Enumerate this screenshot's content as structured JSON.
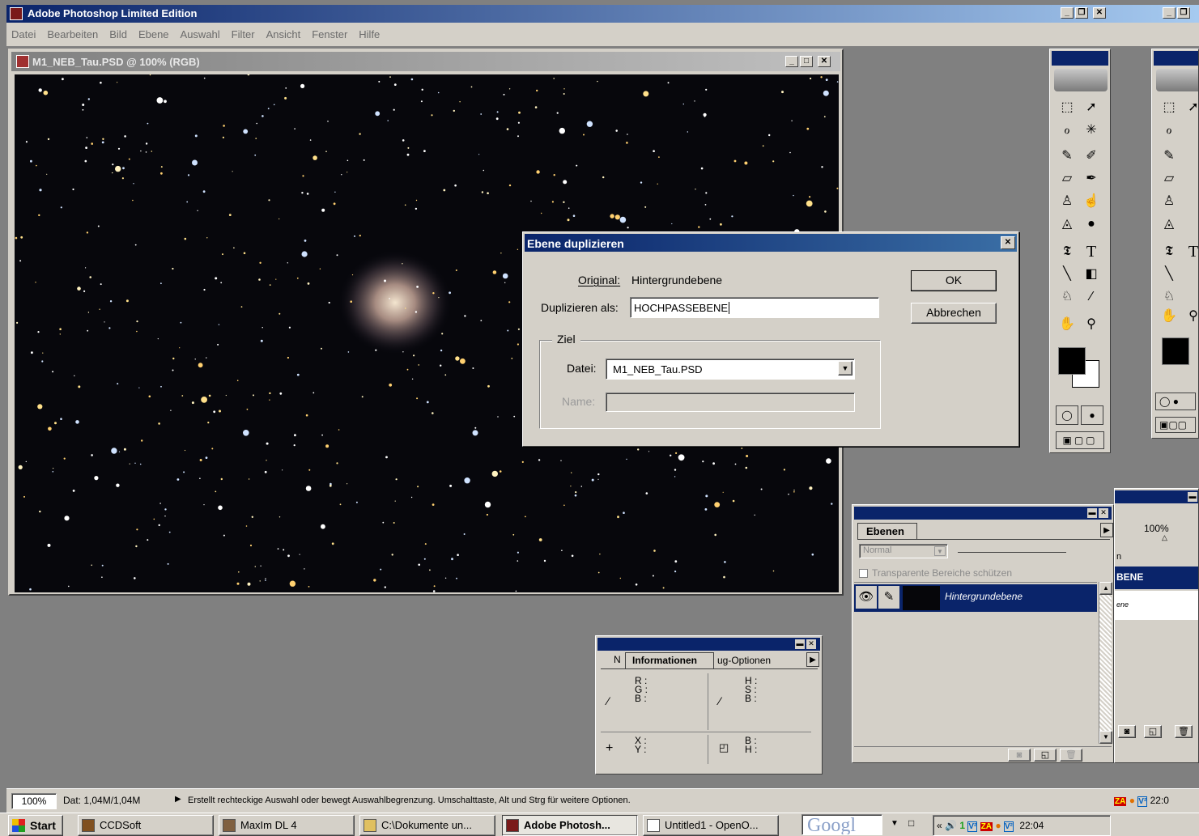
{
  "app": {
    "title": "Adobe Photoshop Limited Edition",
    "menu": [
      "Datei",
      "Bearbeiten",
      "Bild",
      "Ebene",
      "Auswahl",
      "Filter",
      "Ansicht",
      "Fenster",
      "Hilfe"
    ]
  },
  "document": {
    "title": "M1_NEB_Tau.PSD @ 100% (RGB)"
  },
  "dialog": {
    "title": "Ebene duplizieren",
    "original_label": "Original:",
    "original_value": "Hintergrundebene",
    "duplicate_label": "Duplizieren als:",
    "duplicate_value": "HOCHPASSEBENE",
    "ok_label": "OK",
    "cancel_label": "Abbrechen",
    "target_group": "Ziel",
    "file_label": "Datei:",
    "file_value": "M1_NEB_Tau.PSD",
    "name_label": "Name:",
    "name_value": ""
  },
  "layers_panel": {
    "tab": "Ebenen",
    "blend_mode": "Normal",
    "protect_label": "Transparente Bereiche schützen",
    "layer_name": "Hintergrundebene"
  },
  "right_panel": {
    "zoom": "100%",
    "fragment_n": "n",
    "layer_label": "BENE",
    "layer_sub": "ene"
  },
  "info_panel": {
    "tab_left": "N",
    "tab_active": "Informationen",
    "tab_right": "ug-Optionen",
    "rgb": [
      "R :",
      "G :",
      "B :"
    ],
    "hsb": [
      "H :",
      "S :",
      "B :"
    ],
    "xy": [
      "X :",
      "Y :"
    ],
    "bh": [
      "B :",
      "H :"
    ]
  },
  "status": {
    "zoom": "100%",
    "doc_size": "Dat: 1,04M/1,04M",
    "hint": "Erstellt rechteckige Auswahl oder bewegt Auswahlbegrenzung. Umschalttaste, Alt und Strg für weitere Optionen.",
    "right_time": "22:0"
  },
  "taskbar": {
    "start": "Start",
    "items": [
      "CCDSoft",
      "MaxIm DL 4",
      "C:\\Dokumente un...",
      "Adobe Photosh...",
      "Untitled1 - OpenO..."
    ],
    "search": "Googl",
    "clock": "22:04"
  },
  "colors": {
    "title_active": "#0a246a",
    "win_grey": "#d4d0c8",
    "desktop": "#808080",
    "highlight": "#0a246a"
  }
}
